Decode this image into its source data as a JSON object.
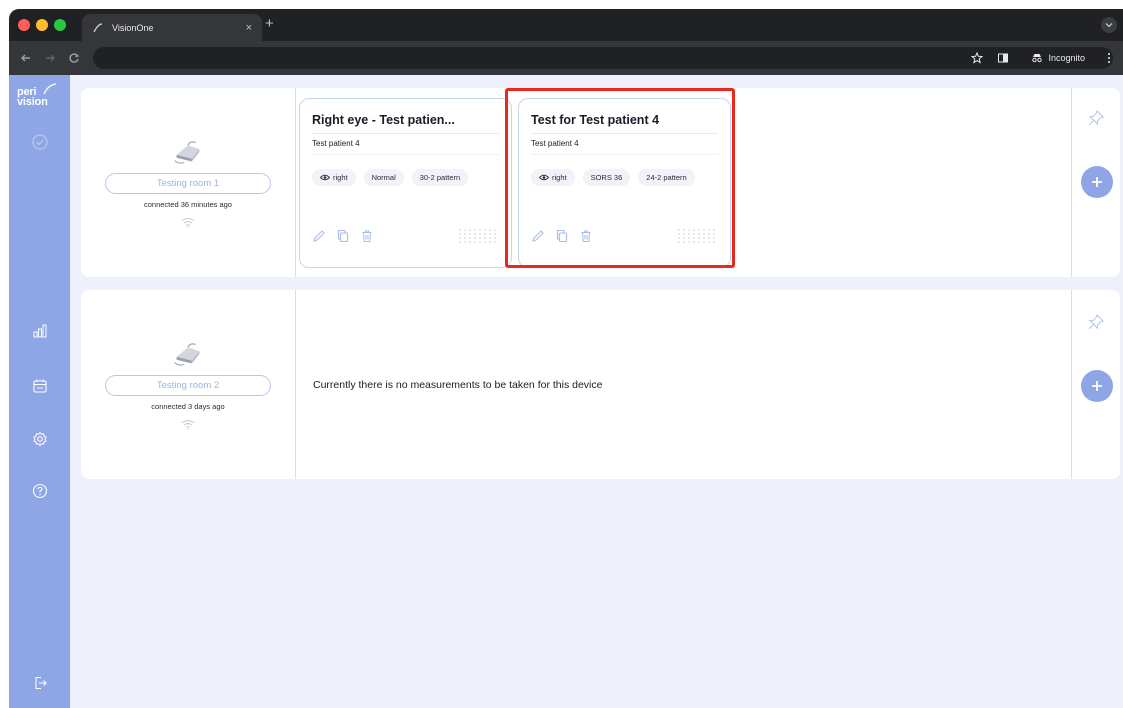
{
  "browser": {
    "tab_title": "VisionOne",
    "tab_close": "×",
    "new_tab": "+",
    "incognito_label": "Incognito",
    "icons": [
      "back-arrow-icon",
      "forward-arrow-icon",
      "reload-icon",
      "star-icon",
      "sidepanel-icon",
      "incognito-icon",
      "more-vert-icon"
    ]
  },
  "sidebar": {
    "logo_top": "peri",
    "logo_bottom": "vision",
    "items": [
      {
        "name": "dashboard-check",
        "icon": "check-circle-icon"
      },
      {
        "name": "statistics",
        "icon": "bar-chart-icon"
      },
      {
        "name": "calendar",
        "icon": "calendar-icon"
      },
      {
        "name": "settings",
        "icon": "gear-icon"
      },
      {
        "name": "help",
        "icon": "question-circle-icon"
      },
      {
        "name": "logout",
        "icon": "logout-icon"
      }
    ]
  },
  "devices": [
    {
      "room_name": "Testing room 1",
      "connected": "connected 36 minutes ago",
      "measurements": [
        {
          "title": "Right eye - Test patien...",
          "patient": "Test patient 4",
          "tags": [
            "right",
            "Normal",
            "30-2 pattern"
          ]
        },
        {
          "title": "Test for Test patient 4",
          "patient": "Test patient 4",
          "tags": [
            "right",
            "SORS 36",
            "24-2 pattern"
          ]
        }
      ]
    },
    {
      "room_name": "Testing room 2",
      "connected": "connected 3 days ago",
      "empty_message": "Currently there is no measurements to be taken for this device"
    }
  ],
  "colors": {
    "accent": "#8ea6e6",
    "background": "#eef1fb",
    "highlight": "#e8291b",
    "chrome_dark": "#202124"
  }
}
